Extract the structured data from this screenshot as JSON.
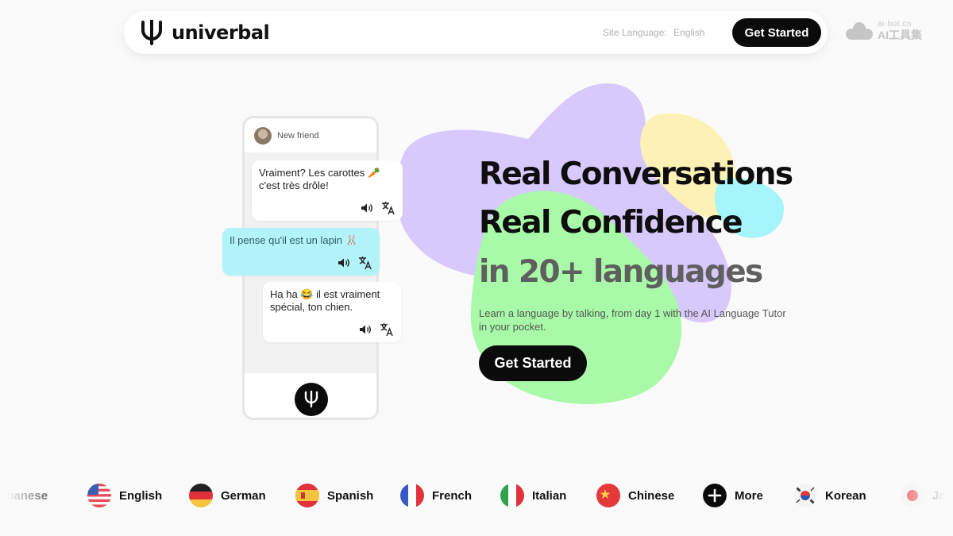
{
  "brand": {
    "name": "univerbal",
    "logo_icon": "tuning-fork-logo-icon"
  },
  "header": {
    "site_language_label": "Site Language:",
    "site_language_value": "English",
    "cta_label": "Get Started"
  },
  "watermark": {
    "top": "ai-bot.cn",
    "bottom": "AI工具集"
  },
  "phone": {
    "contact_name": "New friend",
    "messages": [
      {
        "text": "Vraiment? Les carottes 🥕 c'est très drôle!",
        "from": "friend"
      },
      {
        "text": "Il pense qu'il est un lapin 🐰",
        "from": "me"
      },
      {
        "text": "Ha ha 😂 il est vraiment spécial, ton chien.",
        "from": "friend"
      }
    ],
    "action_icons": [
      "speaker-icon",
      "translate-icon"
    ],
    "mic_icon": "microphone-icon"
  },
  "hero": {
    "line1": "Real Conversations",
    "line2": "Real Confidence",
    "line3": "in 20+ languages",
    "subtitle": "Learn a language by talking, from day 1 with the AI Language Tutor in your pocket.",
    "cta_label": "Get Started"
  },
  "colors": {
    "purple_blob": "#d8c9fd",
    "yellow_blob": "#fef1b6",
    "cyan_blob": "#a5f5fb",
    "green_blob": "#a8f9a8",
    "chat_me_bubble": "#b3f4fb",
    "button": "#0b0b0b"
  },
  "languages": [
    {
      "name": "Japanese",
      "shown": "apanese",
      "flag": "japan-flag-icon"
    },
    {
      "name": "English",
      "flag": "us-flag-icon"
    },
    {
      "name": "German",
      "flag": "germany-flag-icon"
    },
    {
      "name": "Spanish",
      "flag": "spain-flag-icon"
    },
    {
      "name": "French",
      "flag": "france-flag-icon"
    },
    {
      "name": "Italian",
      "flag": "italy-flag-icon"
    },
    {
      "name": "Chinese",
      "flag": "china-flag-icon"
    },
    {
      "name": "More",
      "flag": "plus-icon"
    },
    {
      "name": "Korean",
      "flag": "korea-flag-icon"
    },
    {
      "name": "Japanese",
      "shown": "Jap",
      "flag": "japan-flag-icon"
    }
  ]
}
